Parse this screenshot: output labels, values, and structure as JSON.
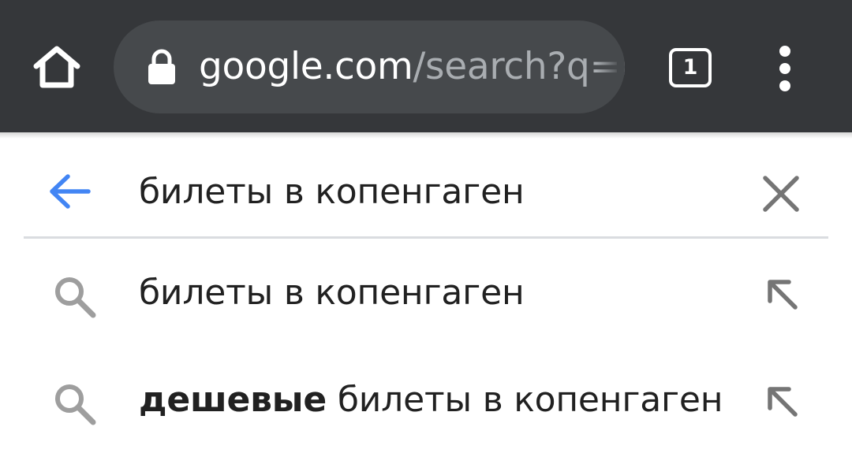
{
  "colors": {
    "toolbar_bg": "#35373a",
    "omnibox_bg": "#46494c",
    "url_domain": "#ffffff",
    "url_path": "#a9adb1",
    "accent_blue": "#4285f4",
    "icon_gray": "#757575",
    "text_primary": "#212121",
    "divider": "#dadce0"
  },
  "toolbar": {
    "home_icon": "home-icon",
    "url_domain": "google.com",
    "url_path": "/search?q=g",
    "secure_icon": "lock-icon",
    "tab_count": "1",
    "menu_icon": "more-vert-icon"
  },
  "search": {
    "back_icon": "arrow-back-icon",
    "query": "билеты в копенгаген",
    "clear_icon": "close-icon"
  },
  "suggestions": [
    {
      "icon": "search-icon",
      "bold": "",
      "text": "билеты в копенгаген",
      "fill_icon": "arrow-up-left-icon"
    },
    {
      "icon": "search-icon",
      "bold": "дешевые",
      "text": " билеты в копенгаген",
      "fill_icon": "arrow-up-left-icon"
    }
  ]
}
